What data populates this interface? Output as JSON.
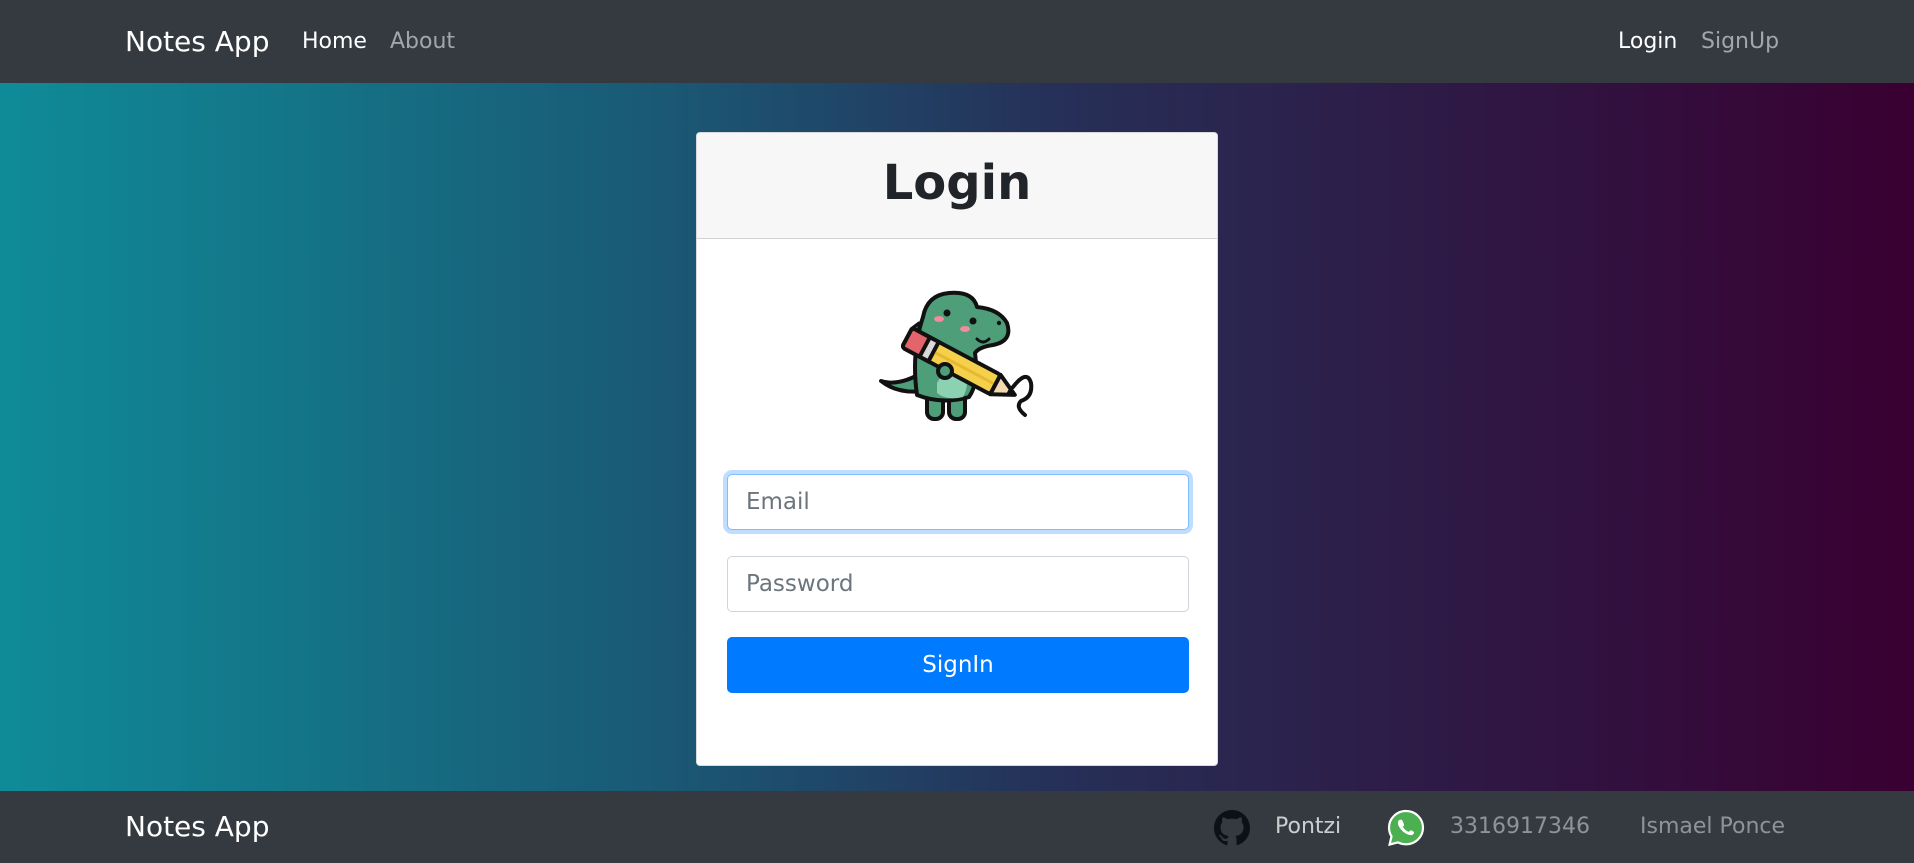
{
  "navbar": {
    "brand": "Notes App",
    "links": [
      {
        "label": "Home",
        "active": true
      },
      {
        "label": "About",
        "active": false
      }
    ],
    "right_links": [
      {
        "label": "Login",
        "active": true
      },
      {
        "label": "SignUp",
        "active": false
      }
    ]
  },
  "login_card": {
    "title": "Login",
    "mascot_icon": "dinosaur-with-pencil",
    "email": {
      "value": "",
      "placeholder": "Email"
    },
    "password": {
      "value": "",
      "placeholder": "Password"
    },
    "submit_label": "SignIn"
  },
  "footer": {
    "brand": "Notes App",
    "github": {
      "icon": "github-icon",
      "label": "Pontzi"
    },
    "whatsapp": {
      "icon": "whatsapp-icon",
      "label": "3316917346"
    },
    "author": "Ismael Ponce"
  },
  "colors": {
    "navbar_bg": "#343a40",
    "primary": "#007bff",
    "gradient_start": "#0f8b98",
    "gradient_end": "#390031"
  }
}
